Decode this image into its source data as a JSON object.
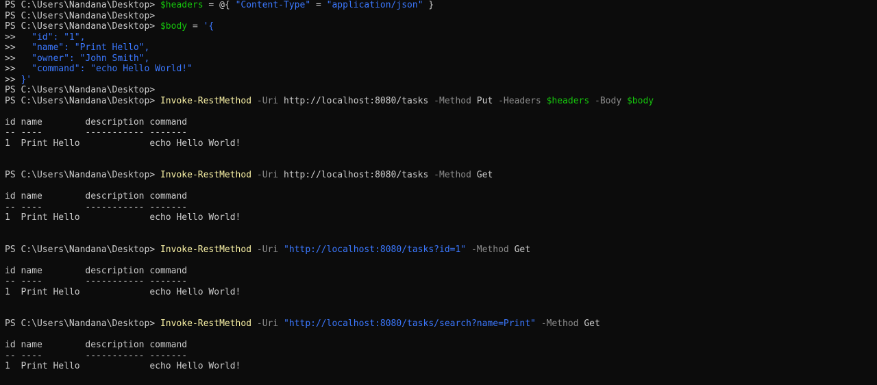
{
  "lines": [
    [
      {
        "t": "PS C:\\Users\\Nandana\\Desktop> ",
        "c": "default"
      },
      {
        "t": "$headers",
        "c": "var"
      },
      {
        "t": " = @{ ",
        "c": "op"
      },
      {
        "t": "\"Content-Type\"",
        "c": "str"
      },
      {
        "t": " = ",
        "c": "op"
      },
      {
        "t": "\"application/json\"",
        "c": "str"
      },
      {
        "t": " }",
        "c": "op"
      }
    ],
    [
      {
        "t": "PS C:\\Users\\Nandana\\Desktop>",
        "c": "default"
      }
    ],
    [
      {
        "t": "PS C:\\Users\\Nandana\\Desktop> ",
        "c": "default"
      },
      {
        "t": "$body",
        "c": "var"
      },
      {
        "t": " = ",
        "c": "op"
      },
      {
        "t": "'{",
        "c": "str"
      }
    ],
    [
      {
        "t": ">> ",
        "c": "default"
      },
      {
        "t": "  \"id\": \"1\",",
        "c": "str"
      }
    ],
    [
      {
        "t": ">> ",
        "c": "default"
      },
      {
        "t": "  \"name\": \"Print Hello\",",
        "c": "str"
      }
    ],
    [
      {
        "t": ">> ",
        "c": "default"
      },
      {
        "t": "  \"owner\": \"John Smith\",",
        "c": "str"
      }
    ],
    [
      {
        "t": ">> ",
        "c": "default"
      },
      {
        "t": "  \"command\": \"echo Hello World!\"",
        "c": "str"
      }
    ],
    [
      {
        "t": ">> ",
        "c": "default"
      },
      {
        "t": "}'",
        "c": "str"
      }
    ],
    [
      {
        "t": "PS C:\\Users\\Nandana\\Desktop>",
        "c": "default"
      }
    ],
    [
      {
        "t": "PS C:\\Users\\Nandana\\Desktop> ",
        "c": "default"
      },
      {
        "t": "Invoke-RestMethod",
        "c": "cmd"
      },
      {
        "t": " -Uri ",
        "c": "param"
      },
      {
        "t": "http://localhost:8080/tasks",
        "c": "default"
      },
      {
        "t": " -Method ",
        "c": "param"
      },
      {
        "t": "Put",
        "c": "default"
      },
      {
        "t": " -Headers ",
        "c": "param"
      },
      {
        "t": "$headers",
        "c": "var"
      },
      {
        "t": " -Body ",
        "c": "param"
      },
      {
        "t": "$body",
        "c": "var"
      }
    ],
    [
      {
        "t": "",
        "c": "default"
      }
    ],
    [
      {
        "t": "id name        description command",
        "c": "default"
      }
    ],
    [
      {
        "t": "-- ----        ----------- -------",
        "c": "default"
      }
    ],
    [
      {
        "t": "1  Print Hello             echo Hello World!",
        "c": "default"
      }
    ],
    [
      {
        "t": "",
        "c": "default"
      }
    ],
    [
      {
        "t": "",
        "c": "default"
      }
    ],
    [
      {
        "t": "PS C:\\Users\\Nandana\\Desktop> ",
        "c": "default"
      },
      {
        "t": "Invoke-RestMethod",
        "c": "cmd"
      },
      {
        "t": " -Uri ",
        "c": "param"
      },
      {
        "t": "http://localhost:8080/tasks",
        "c": "default"
      },
      {
        "t": " -Method ",
        "c": "param"
      },
      {
        "t": "Get",
        "c": "default"
      }
    ],
    [
      {
        "t": "",
        "c": "default"
      }
    ],
    [
      {
        "t": "id name        description command",
        "c": "default"
      }
    ],
    [
      {
        "t": "-- ----        ----------- -------",
        "c": "default"
      }
    ],
    [
      {
        "t": "1  Print Hello             echo Hello World!",
        "c": "default"
      }
    ],
    [
      {
        "t": "",
        "c": "default"
      }
    ],
    [
      {
        "t": "",
        "c": "default"
      }
    ],
    [
      {
        "t": "PS C:\\Users\\Nandana\\Desktop> ",
        "c": "default"
      },
      {
        "t": "Invoke-RestMethod",
        "c": "cmd"
      },
      {
        "t": " -Uri ",
        "c": "param"
      },
      {
        "t": "\"http://localhost:8080/tasks?id=1\"",
        "c": "str"
      },
      {
        "t": " -Method ",
        "c": "param"
      },
      {
        "t": "Get",
        "c": "default"
      }
    ],
    [
      {
        "t": "",
        "c": "default"
      }
    ],
    [
      {
        "t": "id name        description command",
        "c": "default"
      }
    ],
    [
      {
        "t": "-- ----        ----------- -------",
        "c": "default"
      }
    ],
    [
      {
        "t": "1  Print Hello             echo Hello World!",
        "c": "default"
      }
    ],
    [
      {
        "t": "",
        "c": "default"
      }
    ],
    [
      {
        "t": "",
        "c": "default"
      }
    ],
    [
      {
        "t": "PS C:\\Users\\Nandana\\Desktop> ",
        "c": "default"
      },
      {
        "t": "Invoke-RestMethod",
        "c": "cmd"
      },
      {
        "t": " -Uri ",
        "c": "param"
      },
      {
        "t": "\"http://localhost:8080/tasks/search?name=Print\"",
        "c": "str"
      },
      {
        "t": " -Method ",
        "c": "param"
      },
      {
        "t": "Get",
        "c": "default"
      }
    ],
    [
      {
        "t": "",
        "c": "default"
      }
    ],
    [
      {
        "t": "id name        description command",
        "c": "default"
      }
    ],
    [
      {
        "t": "-- ----        ----------- -------",
        "c": "default"
      }
    ],
    [
      {
        "t": "1  Print Hello             echo Hello World!",
        "c": "default"
      }
    ]
  ],
  "colors": {
    "background": "#0c0c0c",
    "default": "#cccccc",
    "cmd": "#f9f1a5",
    "var": "#16c60c",
    "str": "#3b78ff",
    "param": "#8c8c8c"
  }
}
